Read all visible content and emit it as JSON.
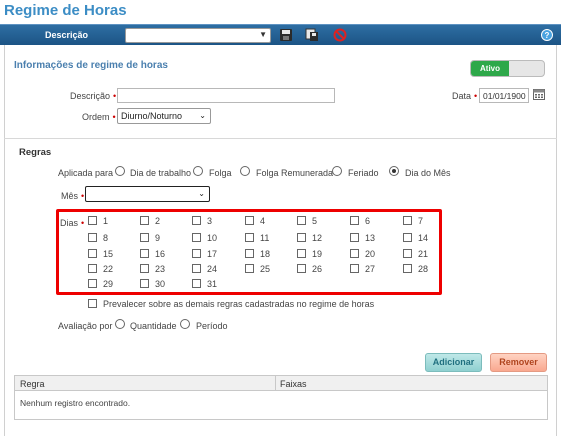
{
  "window": {
    "title": "Regime de Horas"
  },
  "toolbar": {
    "label": "Descrição",
    "select_value": ""
  },
  "info": {
    "section_title": "Informações de regime de horas",
    "toggle_label": "Ativo",
    "descricao_label": "Descrição",
    "descricao_value": "",
    "ordem_label": "Ordem",
    "ordem_value": "Diurno/Noturno",
    "data_label": "Data",
    "data_value": "01/01/1900"
  },
  "regras": {
    "section_title": "Regras",
    "aplicada_label": "Aplicada para",
    "aplicada_options": [
      "Dia de trabalho",
      "Folga",
      "Folga Remunerada",
      "Feriado",
      "Dia do Mês"
    ],
    "aplicada_selected": "Dia do Mês",
    "mes_label": "Mês",
    "mes_value": "",
    "dias_label": "Dias",
    "days": [
      "1",
      "2",
      "3",
      "4",
      "5",
      "6",
      "7",
      "8",
      "9",
      "10",
      "11",
      "12",
      "13",
      "14",
      "15",
      "16",
      "17",
      "18",
      "19",
      "20",
      "21",
      "22",
      "23",
      "24",
      "25",
      "26",
      "27",
      "28",
      "29",
      "30",
      "31"
    ],
    "prevalecer_label": "Prevalecer sobre as demais regras cadastradas no regime de horas",
    "avaliacao_label": "Avaliação por",
    "avaliacao_options": [
      "Quantidade",
      "Período"
    ]
  },
  "buttons": {
    "add": "Adicionar",
    "remove": "Remover"
  },
  "grid": {
    "columns": [
      "Regra",
      "Faixas"
    ],
    "empty_message": "Nenhum registro encontrado."
  },
  "colors": {
    "accent": "#3c8dc5",
    "toolbar": "#1c5485",
    "active": "#2ea84a",
    "highlight": "#ee0000"
  }
}
